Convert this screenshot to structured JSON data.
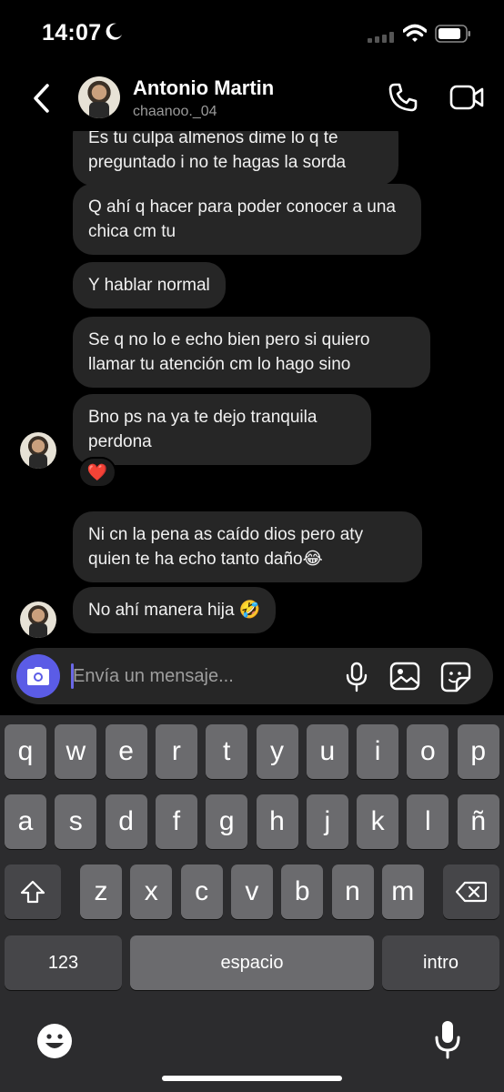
{
  "status_bar": {
    "time": "14:07"
  },
  "header": {
    "contact_name": "Antonio Martin",
    "contact_handle": "chaanoo._04"
  },
  "messages": [
    {
      "text": "Es tu culpa almenos dime lo q te preguntado i no te hagas la sorda"
    },
    {
      "text": "Q ahí q hacer para poder conocer a una chica cm tu"
    },
    {
      "text": "Y hablar normal"
    },
    {
      "text": "Se q no lo e echo bien pero si quiero llamar tu atención cm lo hago sino"
    },
    {
      "text": "Bno ps na ya te dejo tranquila perdona",
      "reaction": "❤️"
    },
    {
      "text": "Ni cn la pena as caído dios pero aty quien te ha echo tanto daño😂"
    },
    {
      "text": "No ahí manera hija 🤣"
    }
  ],
  "composer": {
    "placeholder": "Envía un mensaje..."
  },
  "keyboard": {
    "row1": [
      "q",
      "w",
      "e",
      "r",
      "t",
      "y",
      "u",
      "i",
      "o",
      "p"
    ],
    "row2": [
      "a",
      "s",
      "d",
      "f",
      "g",
      "h",
      "j",
      "k",
      "l",
      "ñ"
    ],
    "row3": [
      "z",
      "x",
      "c",
      "v",
      "b",
      "n",
      "m"
    ],
    "numbers_label": "123",
    "space_label": "espacio",
    "return_label": "intro"
  },
  "colors": {
    "accent": "#5b5ce6",
    "bubble": "#262626",
    "keyboard_bg": "#2c2c2e",
    "key": "#6b6b6e"
  },
  "icons": [
    "moon-icon",
    "signal-icon",
    "wifi-icon",
    "battery-icon",
    "back-icon",
    "phone-icon",
    "video-icon",
    "camera-icon",
    "mic-icon",
    "gallery-icon",
    "sticker-icon",
    "shift-icon",
    "backspace-icon",
    "emoji-icon",
    "dictation-icon"
  ]
}
